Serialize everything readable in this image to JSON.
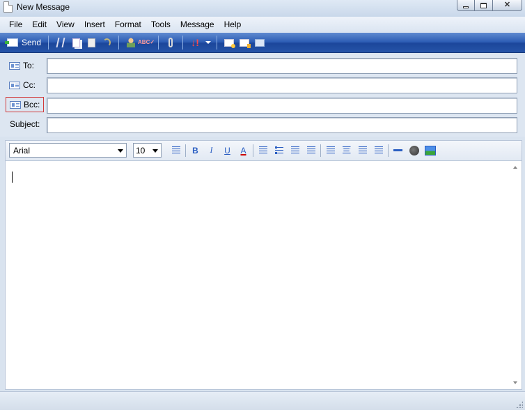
{
  "window": {
    "title": "New Message",
    "controls": [
      "minimize",
      "maximize",
      "close"
    ]
  },
  "menu": [
    "File",
    "Edit",
    "View",
    "Insert",
    "Format",
    "Tools",
    "Message",
    "Help"
  ],
  "toolbar": {
    "send_label": "Send",
    "icons": [
      "send-icon",
      "cut-icon",
      "copy-icon",
      "paste-icon",
      "undo-icon",
      "check-names-icon",
      "spelling-icon",
      "attach-icon",
      "priority-icon",
      "priority-dropdown-icon",
      "sign-icon",
      "encrypt-icon",
      "work-offline-icon"
    ]
  },
  "fields": {
    "to_label": "To:",
    "cc_label": "Cc:",
    "bcc_label": "Bcc:",
    "subject_label": "Subject:",
    "to_value": "",
    "cc_value": "",
    "bcc_value": "",
    "subject_value": ""
  },
  "format": {
    "font": "Arial",
    "size": "10",
    "buttons": [
      "paragraph-style",
      "bold",
      "italic",
      "underline",
      "font-color",
      "numbering",
      "bullets",
      "decrease-indent",
      "increase-indent",
      "align-left",
      "align-center",
      "align-right",
      "justify",
      "horizontal-line",
      "hyperlink",
      "insert-picture"
    ],
    "bold_label": "B",
    "italic_label": "I",
    "underline_label": "U",
    "font_color_label": "A"
  },
  "body": {
    "text": ""
  },
  "colors": {
    "toolbar": "#2554a8",
    "focus_border": "#d23a3a",
    "icon_blue": "#2a5ec2"
  }
}
